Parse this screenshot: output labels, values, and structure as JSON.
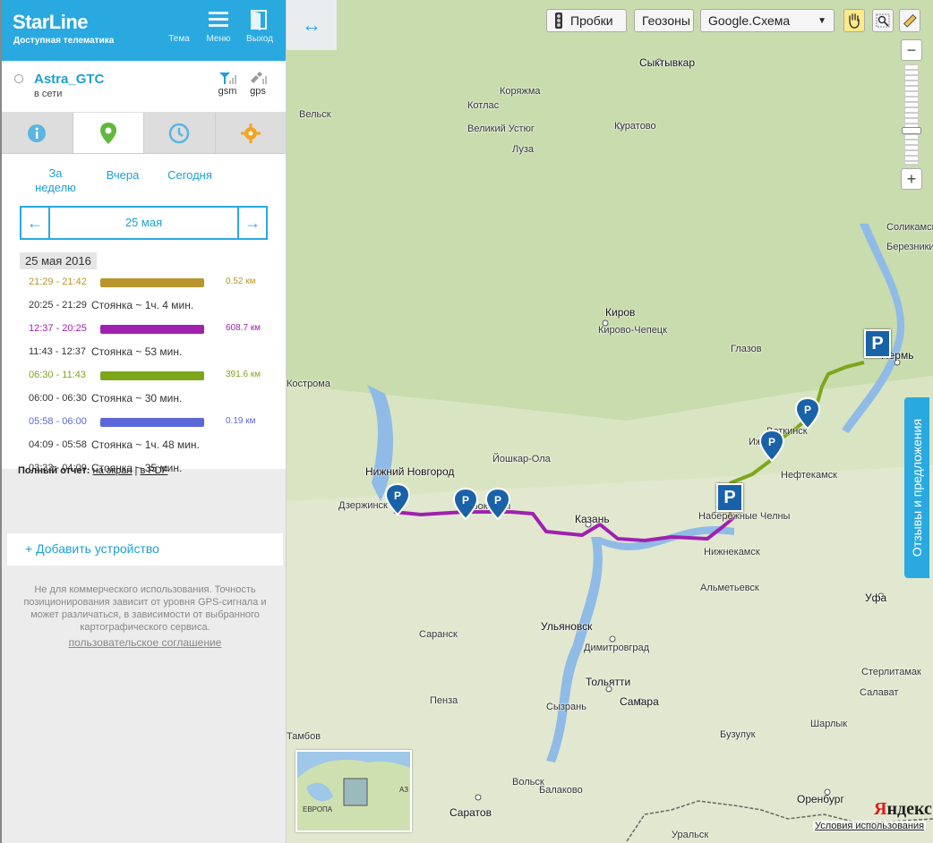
{
  "brand": {
    "name": "StarLine",
    "tagline": "Доступная телематика"
  },
  "topbar": {
    "theme_label": "Тема",
    "menu_label": "Меню",
    "exit_label": "Выход"
  },
  "device": {
    "name": "Astra_GTC",
    "status": "в сети",
    "gsm_label": "gsm",
    "gps_label": "gps"
  },
  "tabs": [
    {
      "icon": "info-icon",
      "active": false
    },
    {
      "icon": "map-pin-icon",
      "active": true
    },
    {
      "icon": "clock-icon",
      "active": false
    },
    {
      "icon": "gear-icon",
      "active": false
    }
  ],
  "periods": {
    "week": "За неделю",
    "yesterday": "Вчера",
    "today": "Сегодня"
  },
  "datenav": {
    "prev": "←",
    "date": "25 мая",
    "next": "→"
  },
  "journal": {
    "day_header": "25 мая 2016",
    "entries": [
      {
        "time": "21:29 - 21:42",
        "type": "trip",
        "color": "#b8952a",
        "distance": "0.52 км"
      },
      {
        "time": "20:25 - 21:29",
        "type": "stop",
        "text": "Стоянка ~ 1ч. 4 мин."
      },
      {
        "time": "12:37 - 20:25",
        "type": "trip",
        "color": "#a020b0",
        "distance": "608.7 км"
      },
      {
        "time": "11:43 - 12:37",
        "type": "stop",
        "text": "Стоянка ~ 53 мин."
      },
      {
        "time": "06:30 - 11:43",
        "type": "trip",
        "color": "#7ea61a",
        "distance": "391.6 км"
      },
      {
        "time": "06:00 - 06:30",
        "type": "stop",
        "text": "Стоянка ~ 30 мин."
      },
      {
        "time": "05:58 - 06:00",
        "type": "trip",
        "color": "#5b68d8",
        "distance": "0.19 км"
      },
      {
        "time": "04:09 - 05:58",
        "type": "stop",
        "text": "Стоянка ~ 1ч. 48 мин."
      },
      {
        "time": "03:33 - 04:09",
        "type": "stop",
        "text": "Стоянка ~ 35 мин."
      }
    ],
    "report_label": "Полный отчет:",
    "report_screen": "на экран",
    "report_sep": "|",
    "report_pdf": "в PDF"
  },
  "add_device": {
    "plus": "+",
    "label": "Добавить устройство"
  },
  "disclaimer": "Не для коммерческого использования. Точность позиционирования зависит от уровня GPS-сигнала и может различаться, в зависимости от выбранного картографического сервиса.",
  "agreement": "пользовательское соглашение",
  "map": {
    "expand": "↔",
    "traffic": "Пробки",
    "geozones": "Геозоны",
    "maptype": "Google.Схема",
    "maptype_arrow": "▼",
    "zoom_out": "−",
    "zoom_in": "+",
    "feedback": "Отзывы и предложения",
    "parking_glyph": "P",
    "yandex_y": "Я",
    "yandex_rest": "ндекс",
    "terms": "Условия использования",
    "minimap_europe": "ЕВРОПА",
    "minimap_az": "АЗ",
    "route_colors": {
      "purple": "#a020b0",
      "green": "#7ea61a",
      "yellow": "#b8952a"
    },
    "labels": [
      {
        "text": "Сыктывкар",
        "big": true
      },
      {
        "text": "Коряжма"
      },
      {
        "text": "Котлас"
      },
      {
        "text": "Вельск"
      },
      {
        "text": "Великий Устюг"
      },
      {
        "text": "Луза"
      },
      {
        "text": "Куратово"
      },
      {
        "text": "Соликамск"
      },
      {
        "text": "Березники"
      },
      {
        "text": "Киров",
        "big": true
      },
      {
        "text": "Кирово-Чепецк"
      },
      {
        "text": "Глазов"
      },
      {
        "text": "Пермь",
        "big": true
      },
      {
        "text": "Кострома"
      },
      {
        "text": "Воткинск"
      },
      {
        "text": "Ижевск"
      },
      {
        "text": "Нефтекамск"
      },
      {
        "text": "Нижний Новгород",
        "big": true
      },
      {
        "text": "Дзержинск"
      },
      {
        "text": "Йошкар-Ола"
      },
      {
        "text": "Чебоксары"
      },
      {
        "text": "Казань",
        "big": true
      },
      {
        "text": "Набережные Челны"
      },
      {
        "text": "Нижнекамск"
      },
      {
        "text": "Альметьевск"
      },
      {
        "text": "Уфа",
        "big": true
      },
      {
        "text": "Саранск"
      },
      {
        "text": "Ульяновск",
        "big": true
      },
      {
        "text": "Димитровград"
      },
      {
        "text": "Стерлитамак"
      },
      {
        "text": "Салават"
      },
      {
        "text": "Тольятти",
        "big": true
      },
      {
        "text": "Самара",
        "big": true
      },
      {
        "text": "Пенза"
      },
      {
        "text": "Сызрань"
      },
      {
        "text": "Бузулук"
      },
      {
        "text": "Шарлык"
      },
      {
        "text": "Тамбов"
      },
      {
        "text": "Вольск"
      },
      {
        "text": "Балаково"
      },
      {
        "text": "Оренбург",
        "big": true
      },
      {
        "text": "Саратов",
        "big": true
      },
      {
        "text": "Уральск"
      }
    ]
  }
}
